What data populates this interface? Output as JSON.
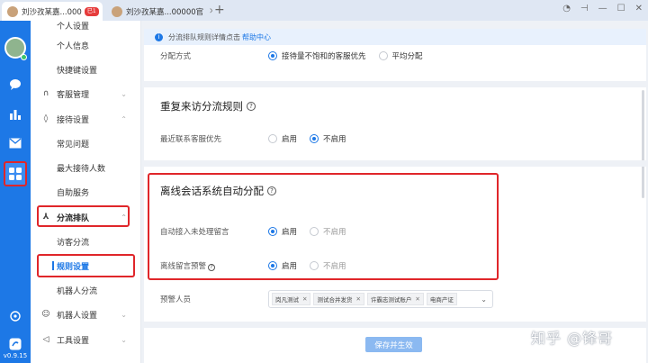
{
  "tabs": [
    {
      "title": "刘沙孜某嘉...000",
      "badge": "已1",
      "close": "✕"
    },
    {
      "title": "刘沙孜某嘉...00000官",
      "close": "✕"
    }
  ],
  "new_tab": "+",
  "version": "v0.9.15",
  "menu": {
    "top_cut": "个人设置",
    "personal_info": "个人信息",
    "shortcut": "快捷键设置",
    "agent_mgmt": "客服管理",
    "reception": "接待设置",
    "faq": "常见问题",
    "max_reception": "最大接待人数",
    "self_service": "自助服务",
    "routing": "分流排队",
    "visitor_routing": "访客分流",
    "rule_settings": "规则设置",
    "bot_routing": "机器人分流",
    "bot_settings": "机器人设置",
    "tool_settings": "工具设置"
  },
  "info": {
    "text": "分流排队规则详情点击",
    "link": "帮助中心"
  },
  "assign": {
    "label": "分配方式",
    "opt1": "接待量不饱和的客服优先",
    "opt2": "平均分配"
  },
  "repeat": {
    "title": "重复来访分流规则",
    "label": "最近联系客服优先",
    "on": "启用",
    "off": "不启用"
  },
  "offline": {
    "title": "离线会话系统自动分配",
    "auto_label": "自动接入未处理留言",
    "warn_label": "离线留言预警",
    "on": "启用",
    "off": "不启用"
  },
  "warn_people": {
    "label": "预警人员",
    "tags": [
      "岗凡测试",
      "测试合并发货",
      "许霸志测试账户",
      "电商产证"
    ]
  },
  "save": "保存并生效",
  "watermark": "知乎 @锋哥",
  "colors": {
    "accent": "#1d78e6",
    "highlight": "#e0262a"
  }
}
